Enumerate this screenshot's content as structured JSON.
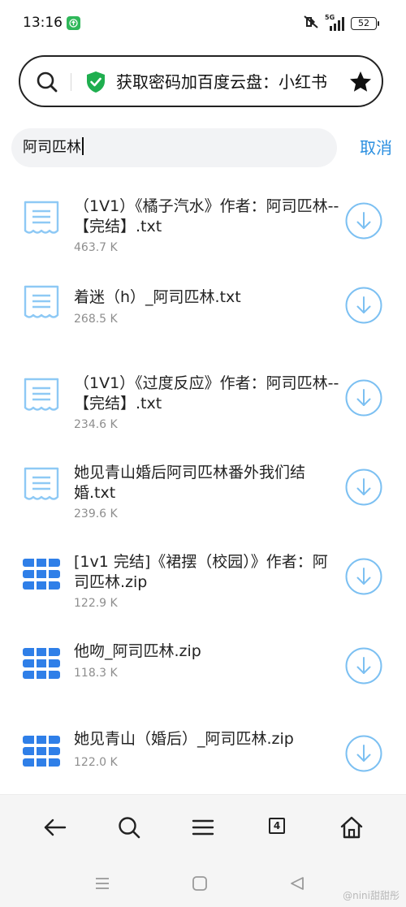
{
  "status_bar": {
    "time": "13:16",
    "network": "5G",
    "battery": "52"
  },
  "address_bar": {
    "title": "获取密码加百度云盘：小红书",
    "icons": [
      "search-icon",
      "shield-check-icon",
      "star-icon"
    ]
  },
  "search": {
    "query": "阿司匹林",
    "cancel_label": "取消"
  },
  "files": [
    {
      "name": "（1V1）《橘子汽水》作者：阿司匹林--【完结】.txt",
      "size": "463.7 K",
      "type": "txt"
    },
    {
      "name": "着迷（h）_阿司匹林.txt",
      "size": "268.5 K",
      "type": "txt"
    },
    {
      "name": "（1V1）《过度反应》作者：阿司匹林--【完结】.txt",
      "size": "234.6 K",
      "type": "txt"
    },
    {
      "name": "她见青山婚后阿司匹林番外我们结婚.txt",
      "size": "239.6 K",
      "type": "txt"
    },
    {
      "name": "[1v1 完结]《裙摆（校园）》作者：阿司匹林.zip",
      "size": "122.9 K",
      "type": "zip"
    },
    {
      "name": "他吻_阿司匹林.zip",
      "size": "118.3 K",
      "type": "zip"
    },
    {
      "name": "她见青山（婚后）_阿司匹林.zip",
      "size": "122.0 K",
      "type": "zip"
    }
  ],
  "toolbar": {
    "tab_count": "4",
    "icons": [
      "back-arrow-icon",
      "search-icon",
      "menu-icon",
      "tabs-icon",
      "home-icon"
    ]
  },
  "nav_bar": {
    "icons": [
      "recent-apps-icon",
      "home-square-icon",
      "back-triangle-icon"
    ]
  },
  "watermark": "@nini甜甜彤",
  "colors": {
    "accent": "#2b8fe0",
    "txt_icon": "#8ec9f5",
    "zip_icon": "#2f7fe8",
    "download_ring": "#7cc0f2",
    "shield": "#1fae4f"
  }
}
